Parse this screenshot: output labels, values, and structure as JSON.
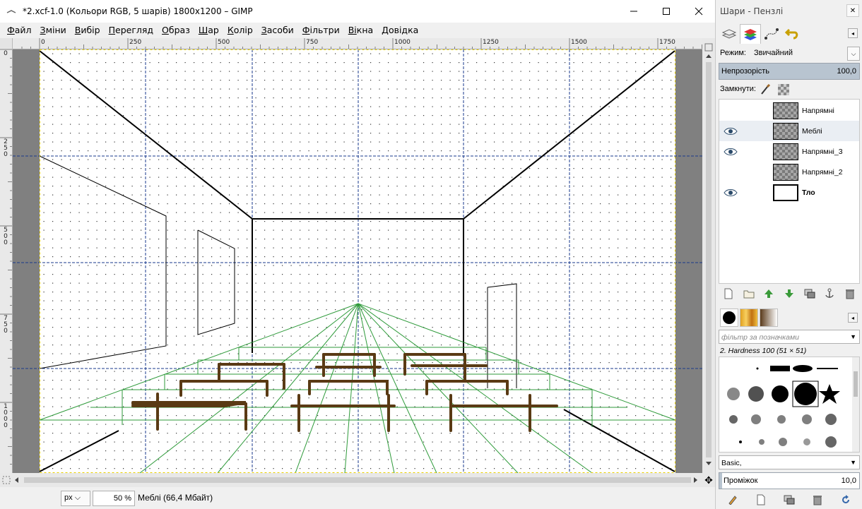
{
  "window": {
    "title": "*2.xcf-1.0 (Кольори RGB, 5 шарів) 1800x1200 – GIMP"
  },
  "menu": [
    {
      "u": "Ф",
      "rest": "айл"
    },
    {
      "u": "З",
      "rest": "міни"
    },
    {
      "u": "В",
      "rest": "ибір"
    },
    {
      "u": "П",
      "rest": "ерегляд"
    },
    {
      "u": "О",
      "rest": "браз"
    },
    {
      "u": "Ш",
      "rest": "ар"
    },
    {
      "u": "К",
      "rest": "олір"
    },
    {
      "u": "З",
      "rest": "асоби"
    },
    {
      "u": "Ф",
      "rest": "ільтри"
    },
    {
      "u": "Ві",
      "rest": "кна"
    },
    {
      "u": "Д",
      "rest": "овідка"
    }
  ],
  "ruler": {
    "top_labels": [
      "0",
      "250",
      "500",
      "750",
      "1000",
      "1250",
      "1500",
      "1750"
    ],
    "left_labels": [
      "0",
      "250",
      "500",
      "750",
      "1000"
    ]
  },
  "status": {
    "unit": "px",
    "zoom": "50 %",
    "text": "Меблі (66,4 Мбайт)"
  },
  "dock": {
    "title": "Шари - Пензлі",
    "mode_label": "Режим:",
    "mode_value": "Звичайний",
    "opacity_label": "Непрозорість",
    "opacity_value": "100,0",
    "opacity_fraction": 1.0,
    "lock_label": "Замкнути:",
    "layers": [
      {
        "name": "Напрямні",
        "visible": false,
        "selected": false,
        "bold": false,
        "thumb": "checker"
      },
      {
        "name": "Меблі",
        "visible": true,
        "selected": true,
        "bold": false,
        "thumb": "checker"
      },
      {
        "name": "Напрямні_3",
        "visible": true,
        "selected": false,
        "bold": false,
        "thumb": "checker"
      },
      {
        "name": "Напрямні_2",
        "visible": false,
        "selected": false,
        "bold": false,
        "thumb": "checker"
      },
      {
        "name": "Тло",
        "visible": true,
        "selected": false,
        "bold": true,
        "thumb": "white"
      }
    ],
    "filter_placeholder": "фільтр за позначками",
    "brush_name": "2. Hardness 100 (51 × 51)",
    "preset": "Basic,",
    "spacing_label": "Проміжок",
    "spacing_value": "10,0",
    "spacing_fraction": 0.1
  },
  "colors": {
    "guide": "#1a3a8c",
    "perspective": "#2e9a3a",
    "furniture": "#5a3a14",
    "accent_fill": "#b8c4d0"
  }
}
